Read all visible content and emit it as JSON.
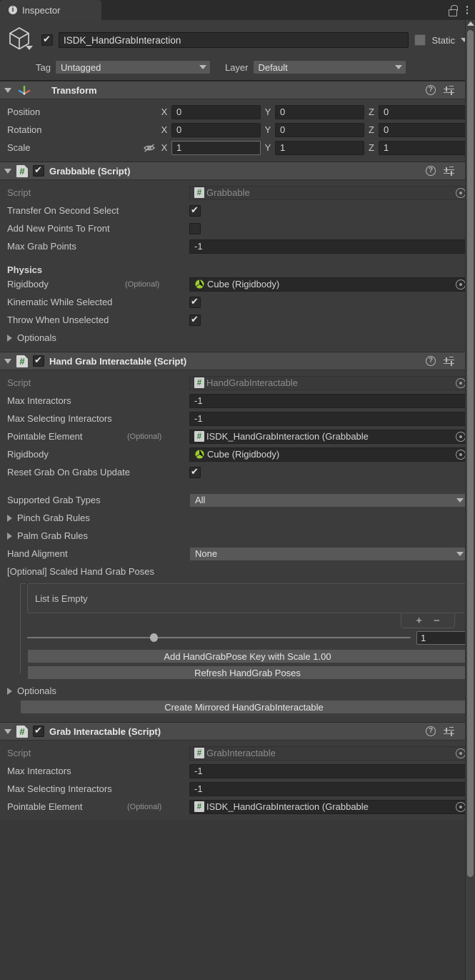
{
  "window": {
    "tab_label": "Inspector",
    "tab_icon": "info-icon",
    "lock_icon": "unlocked-padlock-icon",
    "menu_icon": "kebab-menu-icon"
  },
  "gameobject": {
    "enabled": true,
    "name": "ISDK_HandGrabInteraction",
    "static_label": "Static",
    "static_checked": false,
    "tag_label": "Tag",
    "tag_value": "Untagged",
    "layer_label": "Layer",
    "layer_value": "Default"
  },
  "components": [
    {
      "title": "Transform",
      "icon": "transform-axis-icon",
      "expanded": true,
      "has_enable_checkbox": false,
      "rows": [
        {
          "label": "Position",
          "x": "0",
          "y": "0",
          "z": "0"
        },
        {
          "label": "Rotation",
          "x": "0",
          "y": "0",
          "z": "0"
        },
        {
          "label": "Scale",
          "x": "1",
          "y": "1",
          "z": "1",
          "constrain_icon": "eye-off-icon"
        }
      ]
    },
    {
      "title": "Grabbable (Script)",
      "icon": "cs-script-icon",
      "expanded": true,
      "enabled": true,
      "script_label": "Script",
      "script_value": "Grabbable",
      "fields": [
        {
          "label": "Transfer On Second Select",
          "type": "checkbox",
          "value": true
        },
        {
          "label": "Add New Points To Front",
          "type": "checkbox",
          "value": false
        },
        {
          "label": "Max Grab Points",
          "type": "text",
          "value": "-1"
        }
      ],
      "physics_header": "Physics",
      "physics_fields": [
        {
          "label": "Rigidbody",
          "optional": "(Optional)",
          "type": "object",
          "badge": "rigidbody-icon",
          "value": "Cube (Rigidbody)"
        },
        {
          "label": "Kinematic While Selected",
          "type": "checkbox",
          "value": true
        },
        {
          "label": "Throw When Unselected",
          "type": "checkbox",
          "value": true
        }
      ],
      "optionals_label": "Optionals"
    },
    {
      "title": "Hand Grab Interactable (Script)",
      "icon": "cs-script-icon",
      "expanded": true,
      "enabled": true,
      "script_label": "Script",
      "script_value": "HandGrabInteractable",
      "fields": [
        {
          "label": "Max Interactors",
          "type": "text",
          "value": "-1"
        },
        {
          "label": "Max Selecting Interactors",
          "type": "text",
          "value": "-1"
        },
        {
          "label": "Pointable Element",
          "optional": "(Optional)",
          "type": "object",
          "badge": "cs-script-icon",
          "value": "ISDK_HandGrabInteraction (Grabbable"
        },
        {
          "label": "Rigidbody",
          "type": "object",
          "badge": "rigidbody-icon",
          "value": "Cube (Rigidbody)"
        },
        {
          "label": "Reset Grab On Grabs Update",
          "type": "checkbox",
          "value": true
        }
      ],
      "supported_grab_types_label": "Supported Grab Types",
      "supported_grab_types_value": "All",
      "pinch_grab_rules_label": "Pinch Grab Rules",
      "palm_grab_rules_label": "Palm Grab Rules",
      "hand_alignment_label": "Hand Aligment",
      "hand_alignment_value": "None",
      "scaled_poses_label": "[Optional] Scaled Hand Grab Poses",
      "list_empty_text": "List is Empty",
      "add_button": "+",
      "remove_button": "−",
      "slider_value": "1",
      "slider_percent": 33,
      "add_pose_button": "Add HandGrabPose Key with Scale 1.00",
      "refresh_button": "Refresh HandGrab Poses",
      "optionals_label": "Optionals",
      "mirror_button": "Create Mirrored HandGrabInteractable"
    },
    {
      "title": "Grab Interactable (Script)",
      "icon": "cs-script-icon",
      "expanded": true,
      "enabled": true,
      "script_label": "Script",
      "script_value": "GrabInteractable",
      "fields": [
        {
          "label": "Max Interactors",
          "type": "text",
          "value": "-1"
        },
        {
          "label": "Max Selecting Interactors",
          "type": "text",
          "value": "-1"
        },
        {
          "label": "Pointable Element",
          "optional": "(Optional)",
          "type": "object",
          "badge": "cs-script-icon",
          "value": "ISDK_HandGrabInteraction (Grabbable"
        }
      ]
    }
  ],
  "colors": {
    "panel_bg": "#383838",
    "component_bg": "#3c3c3c",
    "header_bg": "#4b4b4b",
    "field_bg": "#282828",
    "dropdown_bg": "#585858",
    "script_green": "#2e7d32"
  }
}
